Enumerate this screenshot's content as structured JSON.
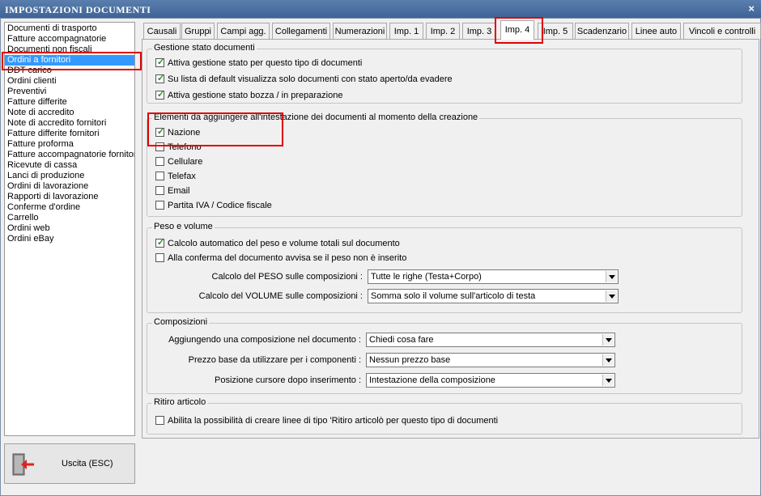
{
  "window": {
    "title": "IMPOSTAZIONI DOCUMENTI",
    "close_glyph": "×"
  },
  "doc_list": [
    {
      "label": "Documenti di trasporto",
      "selected": false
    },
    {
      "label": "Fatture accompagnatorie",
      "selected": false
    },
    {
      "label": "Documenti non fiscali",
      "selected": false
    },
    {
      "label": "Ordini a fornitori",
      "selected": true
    },
    {
      "label": "DDT carico",
      "selected": false
    },
    {
      "label": "Ordini clienti",
      "selected": false
    },
    {
      "label": "Preventivi",
      "selected": false
    },
    {
      "label": "Fatture differite",
      "selected": false
    },
    {
      "label": "Note di accredito",
      "selected": false
    },
    {
      "label": "Note di accredito fornitori",
      "selected": false
    },
    {
      "label": "Fatture differite fornitori",
      "selected": false
    },
    {
      "label": "Fatture proforma",
      "selected": false
    },
    {
      "label": "Fatture accompagnatorie fornitori",
      "selected": false
    },
    {
      "label": "Ricevute di cassa",
      "selected": false
    },
    {
      "label": "Lanci di produzione",
      "selected": false
    },
    {
      "label": "Ordini di lavorazione",
      "selected": false
    },
    {
      "label": "Rapporti di lavorazione",
      "selected": false
    },
    {
      "label": "Conferme d'ordine",
      "selected": false
    },
    {
      "label": "Carrello",
      "selected": false
    },
    {
      "label": "Ordini web",
      "selected": false
    },
    {
      "label": "Ordini eBay",
      "selected": false
    }
  ],
  "exit_button": {
    "label": "Uscita (ESC)",
    "icon": "exit-door-icon"
  },
  "tabs": [
    {
      "label": "Causali",
      "active": false
    },
    {
      "label": "Gruppi",
      "active": false
    },
    {
      "label": "Campi agg.",
      "active": false
    },
    {
      "label": "Collegamenti",
      "active": false
    },
    {
      "label": "Numerazioni",
      "active": false
    },
    {
      "label": "Imp. 1",
      "active": false
    },
    {
      "label": "Imp. 2",
      "active": false
    },
    {
      "label": "Imp. 3",
      "active": false
    },
    {
      "label": "Imp. 4",
      "active": true
    },
    {
      "label": "Imp. 5",
      "active": false
    },
    {
      "label": "Scadenzario",
      "active": false
    },
    {
      "label": "Linee auto",
      "active": false
    },
    {
      "label": "Vincoli e controlli",
      "active": false
    }
  ],
  "gestione": {
    "legend": "Gestione stato documenti",
    "items": [
      {
        "label": "Attiva gestione stato per questo tipo di documenti",
        "checked": true
      },
      {
        "label": "Su lista di default visualizza solo documenti con stato aperto/da evadere",
        "checked": true
      },
      {
        "label": "Attiva gestione stato bozza / in preparazione",
        "checked": true
      }
    ]
  },
  "intestazione": {
    "legend": "Elementi da aggiungere all'intestazione dei documenti al momento della creazione",
    "items": [
      {
        "label": "Nazione",
        "checked": true
      },
      {
        "label": "Telefono",
        "checked": false
      },
      {
        "label": "Cellulare",
        "checked": false
      },
      {
        "label": "Telefax",
        "checked": false
      },
      {
        "label": "Email",
        "checked": false
      },
      {
        "label": "Partita IVA / Codice fiscale",
        "checked": false
      }
    ]
  },
  "peso": {
    "legend": "Peso e volume",
    "items": [
      {
        "label": "Calcolo automatico del peso e volume totali sul documento",
        "checked": true
      },
      {
        "label": "Alla conferma del documento avvisa se il peso non è inserito",
        "checked": false
      }
    ],
    "fields": [
      {
        "label": "Calcolo del PESO sulle composizioni :",
        "value": "Tutte le righe (Testa+Corpo)"
      },
      {
        "label": "Calcolo del VOLUME sulle composizioni :",
        "value": "Somma solo il volume sull'articolo di testa"
      }
    ]
  },
  "composizioni": {
    "legend": "Composizioni",
    "fields": [
      {
        "label": "Aggiungendo una composizione nel documento :",
        "value": "Chiedi cosa fare"
      },
      {
        "label": "Prezzo base da utilizzare per i componenti :",
        "value": "Nessun prezzo base"
      },
      {
        "label": "Posizione cursore dopo inserimento :",
        "value": "Intestazione della composizione"
      }
    ]
  },
  "ritiro": {
    "legend": "Ritiro articolo",
    "items": [
      {
        "label": "Abilita la possibilità di creare linee di tipo 'Ritiro articolò per questo tipo di documenti",
        "checked": false
      }
    ]
  },
  "checkmark_glyph": "✓",
  "colors": {
    "title_bar": "#4a6fa5",
    "selection": "#3399ff",
    "annotation": "#e00000",
    "check": "#2a8a2a"
  }
}
